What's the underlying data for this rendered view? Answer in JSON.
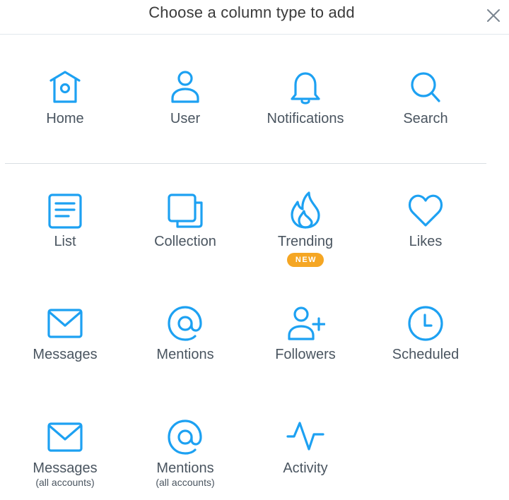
{
  "dialog": {
    "title": "Choose a column type to add",
    "close_icon": "close-icon"
  },
  "accent_color": "#1da1f2",
  "badge_color": "#f5a623",
  "tiles": {
    "home": {
      "label": "Home",
      "icon": "home-icon"
    },
    "user": {
      "label": "User",
      "icon": "user-icon"
    },
    "notifications": {
      "label": "Notifications",
      "icon": "bell-icon"
    },
    "search": {
      "label": "Search",
      "icon": "search-icon"
    },
    "list": {
      "label": "List",
      "icon": "list-icon"
    },
    "collection": {
      "label": "Collection",
      "icon": "collection-icon"
    },
    "trending": {
      "label": "Trending",
      "icon": "flame-icon",
      "badge": "NEW"
    },
    "likes": {
      "label": "Likes",
      "icon": "heart-icon"
    },
    "messages": {
      "label": "Messages",
      "icon": "envelope-icon"
    },
    "mentions": {
      "label": "Mentions",
      "icon": "at-sign-icon"
    },
    "followers": {
      "label": "Followers",
      "icon": "add-user-icon"
    },
    "scheduled": {
      "label": "Scheduled",
      "icon": "clock-icon"
    },
    "messages_all": {
      "label": "Messages",
      "sub": "(all accounts)",
      "icon": "envelope-icon"
    },
    "mentions_all": {
      "label": "Mentions",
      "sub": "(all accounts)",
      "icon": "at-sign-icon"
    },
    "activity": {
      "label": "Activity",
      "icon": "activity-icon"
    }
  }
}
